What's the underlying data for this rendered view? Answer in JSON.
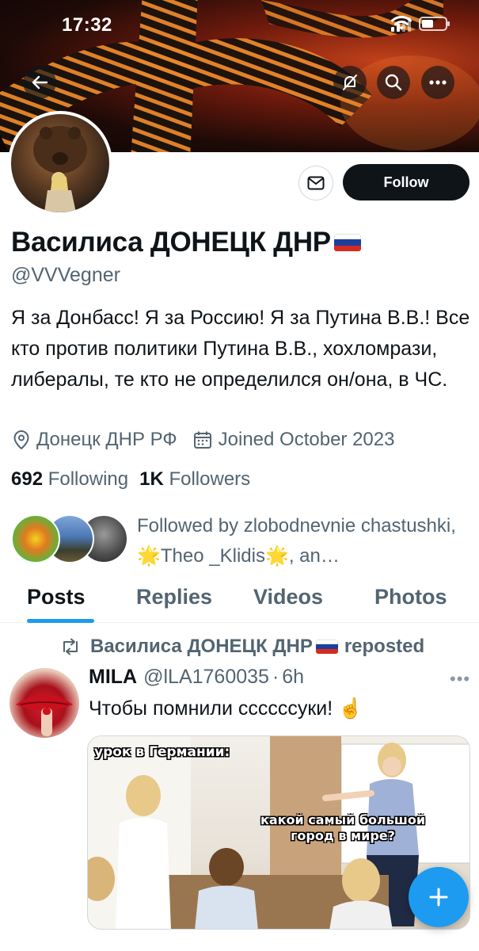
{
  "status_bar": {
    "time": "17:32"
  },
  "profile": {
    "display_name": "Василиса ДОНЕЦК ДНР",
    "handle": "@VVVegner",
    "bio": "Я за Донбасс! Я за Россию! Я за Путина В.В.! Все кто против политики Путина В.В., хохломрази, либералы, те кто не определился он/она, в ЧС.",
    "location": "Донецк ДНР РФ",
    "joined": "Joined October 2023",
    "following_count": "692",
    "following_label": "Following",
    "followers_count": "1K",
    "followers_label": "Followers",
    "followed_by": "Followed by zlobodnevnie chastushki, 🌟Theo _Klidis🌟, an…"
  },
  "actions": {
    "follow_label": "Follow"
  },
  "tabs": [
    {
      "label": "Posts",
      "active": true
    },
    {
      "label": "Replies",
      "active": false
    },
    {
      "label": "Videos",
      "active": false
    },
    {
      "label": "Photos",
      "active": false
    }
  ],
  "post": {
    "repost_by": "Василиса ДОНЕЦК ДНР",
    "repost_label": "reposted",
    "author_name": "MILA",
    "author_handle": "@lLA1760035",
    "separator": "·",
    "time": "6h",
    "text": "Чтобы помнили ссссссуки! ☝️",
    "media": {
      "caption_top": "урок в Германии:",
      "caption_speech": "какой самый большой\nгород в мире?"
    }
  },
  "colors": {
    "accent": "#1d9bf0",
    "text_primary": "#0f1419",
    "text_secondary": "#536471",
    "follow_button_bg": "#0f1419"
  },
  "icons": {
    "back": "arrow-left-icon",
    "notifications_off": "bell-slash-icon",
    "search": "search-icon",
    "more": "more-horizontal-icon",
    "message": "envelope-icon",
    "location": "location-pin-icon",
    "calendar": "calendar-icon",
    "repost": "repost-icon",
    "compose": "plus-icon"
  }
}
